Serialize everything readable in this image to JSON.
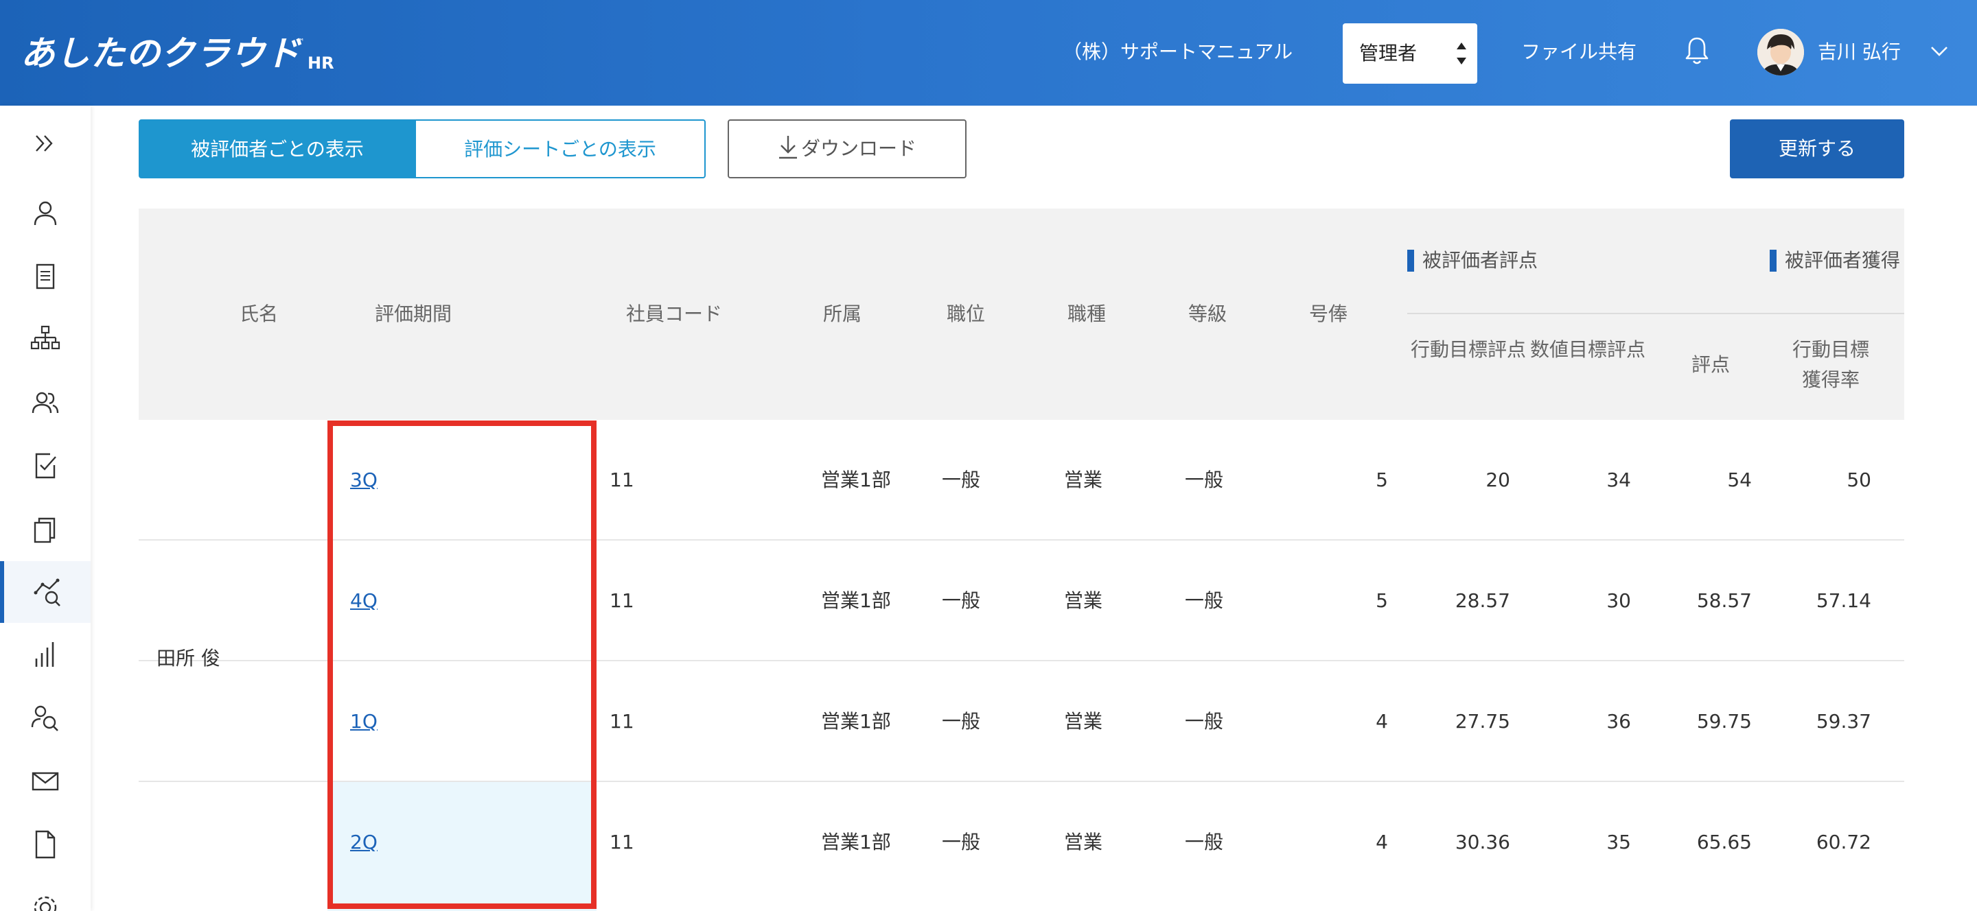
{
  "header": {
    "logo": "あしたのクラウド",
    "logo_suffix": "HR",
    "logo_tm": "™",
    "company": "（株）サポートマニュアル",
    "role_selected": "管理者",
    "file_share": "ファイル共有",
    "username": "吉川 弘行"
  },
  "toolbar": {
    "view_by_evaluatee": "被評価者ごとの表示",
    "view_by_sheet": "評価シートごとの表示",
    "download": "ダウンロード",
    "update": "更新する"
  },
  "table": {
    "headers": {
      "name": "氏名",
      "period": "評価期間",
      "employee_code": "社員コード",
      "department": "所属",
      "position": "職位",
      "job_type": "職種",
      "grade": "等級",
      "pay_step": "号俸"
    },
    "group1": {
      "title": "被評価者評点",
      "sub1": "行動目標評点",
      "sub2": "数値目標評点",
      "sub3": "評点"
    },
    "group2": {
      "title": "被評価者獲得",
      "sub1": "行動目標獲得率"
    },
    "evaluatee_name": "田所 俊",
    "rows": [
      {
        "period": "3Q",
        "code": "11",
        "dept": "営業1部",
        "position": "一般",
        "job": "営業",
        "grade": "一般",
        "step": "5",
        "action_score": "20",
        "numeric_score": "34",
        "score": "54",
        "action_rate": "50"
      },
      {
        "period": "4Q",
        "code": "11",
        "dept": "営業1部",
        "position": "一般",
        "job": "営業",
        "grade": "一般",
        "step": "5",
        "action_score": "28.57",
        "numeric_score": "30",
        "score": "58.57",
        "action_rate": "57.14"
      },
      {
        "period": "1Q",
        "code": "11",
        "dept": "営業1部",
        "position": "一般",
        "job": "営業",
        "grade": "一般",
        "step": "4",
        "action_score": "27.75",
        "numeric_score": "36",
        "score": "59.75",
        "action_rate": "59.37"
      },
      {
        "period": "2Q",
        "code": "11",
        "dept": "営業1部",
        "position": "一般",
        "job": "営業",
        "grade": "一般",
        "step": "4",
        "action_score": "30.36",
        "numeric_score": "35",
        "score": "65.65",
        "action_rate": "60.72"
      }
    ]
  },
  "colors": {
    "header_blue": "#1c63b8",
    "segment_blue": "#1e96cf",
    "highlight_red": "#e63027",
    "row_highlight": "#eaf7fd"
  },
  "icons": {
    "sidebar": [
      "expand-icon",
      "person-icon",
      "document-icon",
      "org-chart-icon",
      "users-icon",
      "checklist-icon",
      "copy-icon",
      "analytics-search-icon",
      "bar-chart-icon",
      "person-search-icon",
      "mail-icon",
      "file-icon",
      "settings-icon"
    ],
    "header": [
      "bell-icon",
      "chevron-down-icon",
      "select-arrows-icon"
    ],
    "toolbar": [
      "download-icon"
    ]
  }
}
